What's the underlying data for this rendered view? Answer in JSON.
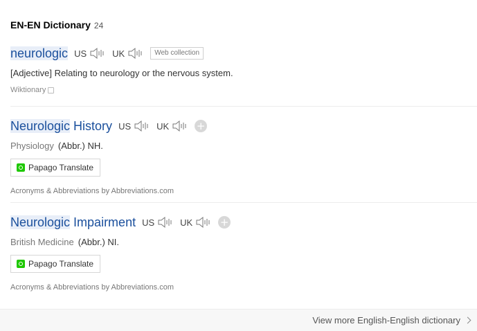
{
  "section": {
    "title": "EN-EN Dictionary",
    "count": "24"
  },
  "entries": [
    {
      "word": "neurologic",
      "word_rest": "",
      "us_label": "US",
      "uk_label": "UK",
      "web_tag": "Web collection",
      "definition": "[Adjective] Relating to neurology or the nervous system.",
      "source": "Wiktionary"
    },
    {
      "word": "Neurologic",
      "word_rest": " History",
      "us_label": "US",
      "uk_label": "UK",
      "field": "Physiology",
      "definition": "(Abbr.) NH.",
      "translate_label": "Papago Translate",
      "source": "Acronyms & Abbreviations by Abbreviations.com"
    },
    {
      "word": "Neurologic",
      "word_rest": " Impairment",
      "us_label": "US",
      "uk_label": "UK",
      "field": "British Medicine",
      "definition": "(Abbr.) NI.",
      "translate_label": "Papago Translate",
      "source": "Acronyms & Abbreviations by Abbreviations.com"
    }
  ],
  "footer": {
    "more_label": "View more English-English dictionary"
  },
  "colors": {
    "word": "#1a4f9c",
    "highlight": "#e8eef8",
    "papago": "#1ec800"
  },
  "icons": {
    "speaker": "speaker-icon",
    "add": "plus-icon",
    "chevron": "chevron-right-icon"
  }
}
